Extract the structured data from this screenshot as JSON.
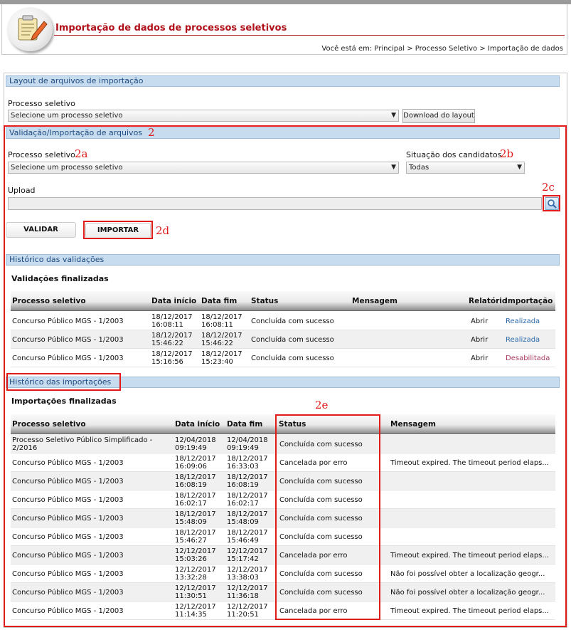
{
  "header": {
    "title": "Importação de dados de processos seletivos",
    "breadcrumb": "Você está em: Principal > Processo Seletivo > Importação de dados"
  },
  "layout_section": {
    "title": "Layout de arquivos de importação",
    "process_label": "Processo seletivo",
    "process_select": "Selecione um processo seletivo",
    "download_button": "Download do layout"
  },
  "validation_section": {
    "title": "Validação/Importação de arquivos",
    "process_label": "Processo seletivo",
    "process_select": "Selecione um processo seletivo",
    "situation_label": "Situação dos candidatos",
    "situation_select": "Todas",
    "upload_label": "Upload",
    "validate_button": "VALIDAR",
    "import_button": "IMPORTAR"
  },
  "annotations": {
    "a2": "2",
    "a2a": "2a",
    "a2b": "2b",
    "a2c": "2c",
    "a2d": "2d",
    "a2e": "2e"
  },
  "validations": {
    "title": "Histórico das validações",
    "subtitle": "Validações finalizadas",
    "columns": [
      "Processo seletivo",
      "Data início",
      "Data fim",
      "Status",
      "Mensagem",
      "Relatório",
      "Importação"
    ],
    "rows": [
      {
        "process": "Concurso Público MGS - 1/2003",
        "start_d": "18/12/2017",
        "start_t": "16:08:11",
        "end_d": "18/12/2017",
        "end_t": "16:08:11",
        "status": "Concluída com sucesso",
        "message": "",
        "report": "Abrir",
        "import": "Realizada"
      },
      {
        "process": "Concurso Público MGS - 1/2003",
        "start_d": "18/12/2017",
        "start_t": "15:46:22",
        "end_d": "18/12/2017",
        "end_t": "15:46:22",
        "status": "Concluída com sucesso",
        "message": "",
        "report": "Abrir",
        "import": "Realizada"
      },
      {
        "process": "Concurso Público MGS - 1/2003",
        "start_d": "18/12/2017",
        "start_t": "15:16:56",
        "end_d": "18/12/2017",
        "end_t": "15:23:40",
        "status": "Concluída com sucesso",
        "message": "",
        "report": "Abrir",
        "import": "Desabilitada"
      }
    ]
  },
  "imports": {
    "title": "Histórico das importações",
    "subtitle": "Importações finalizadas",
    "columns": [
      "Processo seletivo",
      "Data início",
      "Data fim",
      "Status",
      "Mensagem"
    ],
    "rows": [
      {
        "process1": "Processo Seletivo Público Simplificado -",
        "process2": "2/2016",
        "start_d": "12/04/2018",
        "start_t": "09:19:49",
        "end_d": "12/04/2018",
        "end_t": "09:19:49",
        "status": "Concluída com sucesso",
        "message": ""
      },
      {
        "process1": "Concurso Público MGS - 1/2003",
        "process2": "",
        "start_d": "18/12/2017",
        "start_t": "16:09:06",
        "end_d": "18/12/2017",
        "end_t": "16:33:03",
        "status": "Cancelada por erro",
        "message": "Timeout expired. The timeout period elaps..."
      },
      {
        "process1": "Concurso Público MGS - 1/2003",
        "process2": "",
        "start_d": "18/12/2017",
        "start_t": "16:08:19",
        "end_d": "18/12/2017",
        "end_t": "16:08:19",
        "status": "Concluída com sucesso",
        "message": ""
      },
      {
        "process1": "Concurso Público MGS - 1/2003",
        "process2": "",
        "start_d": "18/12/2017",
        "start_t": "16:02:17",
        "end_d": "18/12/2017",
        "end_t": "16:02:17",
        "status": "Concluída com sucesso",
        "message": ""
      },
      {
        "process1": "Concurso Público MGS - 1/2003",
        "process2": "",
        "start_d": "18/12/2017",
        "start_t": "15:48:09",
        "end_d": "18/12/2017",
        "end_t": "15:48:09",
        "status": "Concluída com sucesso",
        "message": ""
      },
      {
        "process1": "Concurso Público MGS - 1/2003",
        "process2": "",
        "start_d": "18/12/2017",
        "start_t": "15:46:27",
        "end_d": "18/12/2017",
        "end_t": "15:46:49",
        "status": "Concluída com sucesso",
        "message": ""
      },
      {
        "process1": "Concurso Público MGS - 1/2003",
        "process2": "",
        "start_d": "12/12/2017",
        "start_t": "15:03:26",
        "end_d": "12/12/2017",
        "end_t": "15:17:42",
        "status": "Cancelada por erro",
        "message": "Timeout expired. The timeout period elaps..."
      },
      {
        "process1": "Concurso Público MGS - 1/2003",
        "process2": "",
        "start_d": "12/12/2017",
        "start_t": "13:32:28",
        "end_d": "12/12/2017",
        "end_t": "13:38:03",
        "status": "Concluída com sucesso",
        "message": "Não foi possível obter a localização geogr..."
      },
      {
        "process1": "Concurso Público MGS - 1/2003",
        "process2": "",
        "start_d": "12/12/2017",
        "start_t": "11:30:51",
        "end_d": "12/12/2017",
        "end_t": "11:36:18",
        "status": "Concluída com sucesso",
        "message": "Não foi possível obter a localização geogr..."
      },
      {
        "process1": "Concurso Público MGS - 1/2003",
        "process2": "",
        "start_d": "12/12/2017",
        "start_t": "11:14:35",
        "end_d": "12/12/2017",
        "end_t": "11:20:51",
        "status": "Cancelada por erro",
        "message": "Timeout expired. The timeout period elaps..."
      }
    ]
  },
  "colors": {
    "title": "#b0101a",
    "annotation": "#e11a1a",
    "section_header": "#c8dcf0",
    "link": "#2c69a8",
    "link_disabled": "#a83a5c"
  }
}
